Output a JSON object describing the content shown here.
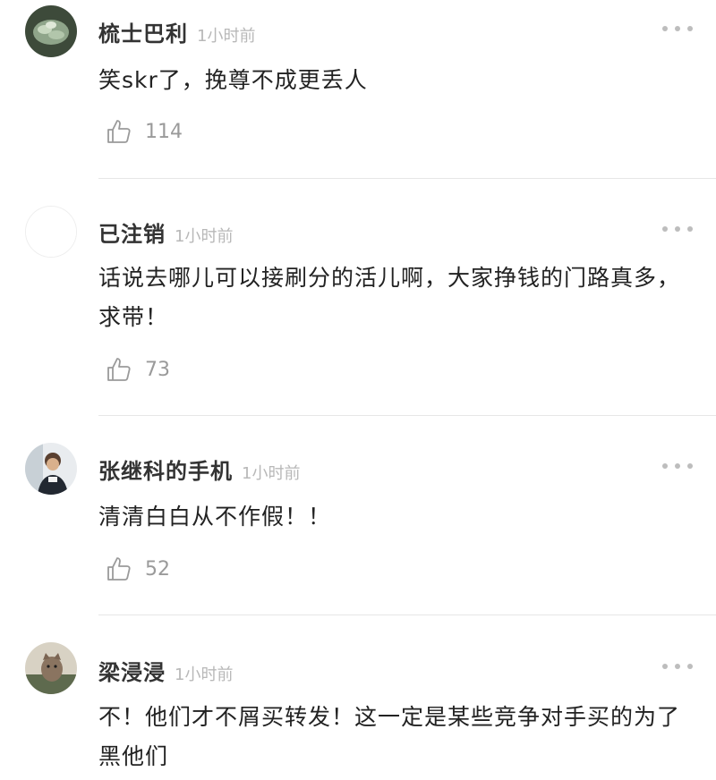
{
  "comments": [
    {
      "username": "梳士巴利",
      "time": "1小时前",
      "text": "笑skr了，挽尊不成更丢人",
      "likes": "114",
      "avatar_icon": "avatar-plant-icon",
      "more_icon": "more-icon",
      "like_icon": "thumbs-up-icon"
    },
    {
      "username": "已注销",
      "time": "1小时前",
      "text": "话说去哪儿可以接刷分的活儿啊，大家挣钱的门路真多，求带！",
      "likes": "73",
      "avatar_icon": "avatar-empty-icon",
      "more_icon": "more-icon",
      "like_icon": "thumbs-up-icon"
    },
    {
      "username": "张继科的手机",
      "time": "1小时前",
      "text": "清清白白从不作假！！",
      "likes": "52",
      "avatar_icon": "avatar-person-icon",
      "more_icon": "more-icon",
      "like_icon": "thumbs-up-icon"
    },
    {
      "username": "梁浸浸",
      "time": "1小时前",
      "text": "不！他们才不屑买转发！这一定是某些竞争对手买的为了黑他们",
      "likes": "",
      "avatar_icon": "avatar-cat-icon",
      "more_icon": "more-icon",
      "like_icon": "thumbs-up-icon"
    }
  ],
  "colors": {
    "username": "#333333",
    "timestamp": "#b8b8b8",
    "text": "#222222",
    "like": "#9a9a9a",
    "divider": "#e6e6e6"
  }
}
